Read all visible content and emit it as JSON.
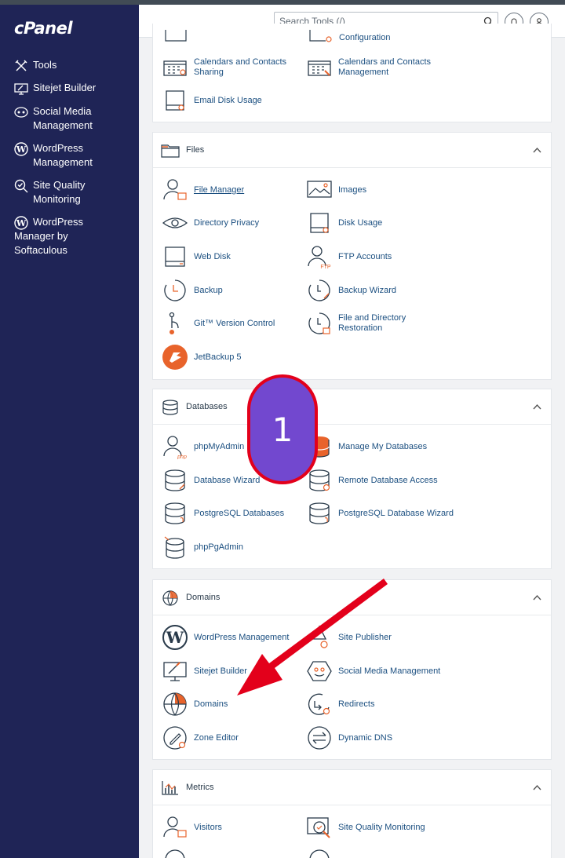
{
  "brand": {
    "logo": "cPanel"
  },
  "search": {
    "placeholder": "Search Tools (/)"
  },
  "sidebar": {
    "items": [
      {
        "label": "Tools"
      },
      {
        "label": "Sitejet Builder"
      },
      {
        "label": "Social Media\nManagement"
      },
      {
        "label": "WordPress\nManagement"
      },
      {
        "label": "Site Quality\nMonitoring"
      },
      {
        "label": "WordPress\nManager by\nSoftaculous"
      }
    ]
  },
  "prev_section": {
    "items": [
      {
        "label": "Configuration"
      },
      {
        "label": "Calendars and Contacts\nSharing"
      },
      {
        "label": "Calendars and Contacts\nManagement"
      },
      {
        "label": "Email Disk Usage"
      }
    ]
  },
  "files": {
    "title": "Files",
    "items": [
      {
        "label": "File Manager"
      },
      {
        "label": "Images"
      },
      {
        "label": "Directory Privacy"
      },
      {
        "label": "Disk Usage"
      },
      {
        "label": "Web Disk"
      },
      {
        "label": "FTP Accounts"
      },
      {
        "label": "Backup"
      },
      {
        "label": "Backup Wizard"
      },
      {
        "label": "Git™ Version Control"
      },
      {
        "label": "File and Directory\nRestoration"
      },
      {
        "label": "JetBackup 5"
      }
    ]
  },
  "databases": {
    "title": "Databases",
    "items": [
      {
        "label": "phpMyAdmin"
      },
      {
        "label": "Manage My Databases"
      },
      {
        "label": "Database Wizard"
      },
      {
        "label": "Remote Database Access"
      },
      {
        "label": "PostgreSQL Databases"
      },
      {
        "label": "PostgreSQL Database Wizard"
      },
      {
        "label": "phpPgAdmin"
      }
    ]
  },
  "domains": {
    "title": "Domains",
    "items": [
      {
        "label": "WordPress Management"
      },
      {
        "label": "Site Publisher"
      },
      {
        "label": "Sitejet Builder"
      },
      {
        "label": "Social Media Management"
      },
      {
        "label": "Domains"
      },
      {
        "label": "Redirects"
      },
      {
        "label": "Zone Editor"
      },
      {
        "label": "Dynamic DNS"
      }
    ]
  },
  "metrics": {
    "title": "Metrics",
    "items": [
      {
        "label": "Visitors"
      },
      {
        "label": "Site Quality Monitoring"
      }
    ]
  },
  "annotation": {
    "step": "1"
  },
  "colors": {
    "sidebar": "#1f2456",
    "accent": "#e8632b",
    "link": "#1b4f80",
    "badge": "#7248cf",
    "arrow": "#e3001b"
  }
}
